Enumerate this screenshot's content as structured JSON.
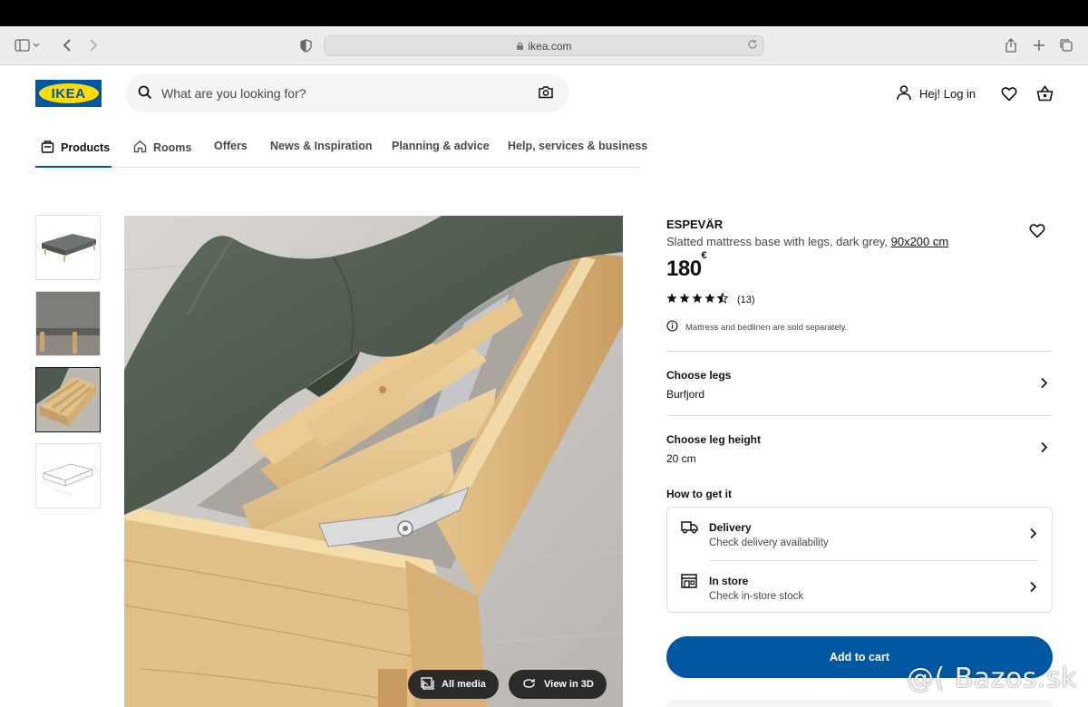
{
  "browser": {
    "url": "ikea.com"
  },
  "header": {
    "logo_text": "IKEA",
    "search_placeholder": "What are you looking for?",
    "login_label": "Hej! Log in"
  },
  "nav": {
    "items": [
      {
        "label": "Products"
      },
      {
        "label": "Rooms"
      },
      {
        "label": "Offers"
      },
      {
        "label": "News & Inspiration"
      },
      {
        "label": "Planning & advice"
      },
      {
        "label": "Help, services & business"
      }
    ]
  },
  "gallery": {
    "selected_index": 2,
    "all_media_label": "All media",
    "view_3d_label": "View in 3D"
  },
  "product": {
    "name": "ESPEVÄR",
    "description": "Slatted mattress base with legs, dark grey,",
    "size": "90x200 cm",
    "price": "180",
    "currency": "€",
    "rating": 4.5,
    "reviews": "(13)",
    "note": "Mattress and bedlinen are sold separately."
  },
  "options": [
    {
      "title": "Choose legs",
      "value": "Burfjord"
    },
    {
      "title": "Choose leg height",
      "value": "20 cm"
    }
  ],
  "get_it": {
    "heading": "How to get it",
    "delivery_title": "Delivery",
    "delivery_sub": "Check delivery availability",
    "store_title": "In store",
    "store_sub": "Check in-store stock"
  },
  "cta": {
    "add_to_cart": "Add to cart"
  },
  "watermark": "@( Bazos.sk",
  "colors": {
    "brand_blue": "#0058a3",
    "brand_yellow": "#ffdb00"
  }
}
